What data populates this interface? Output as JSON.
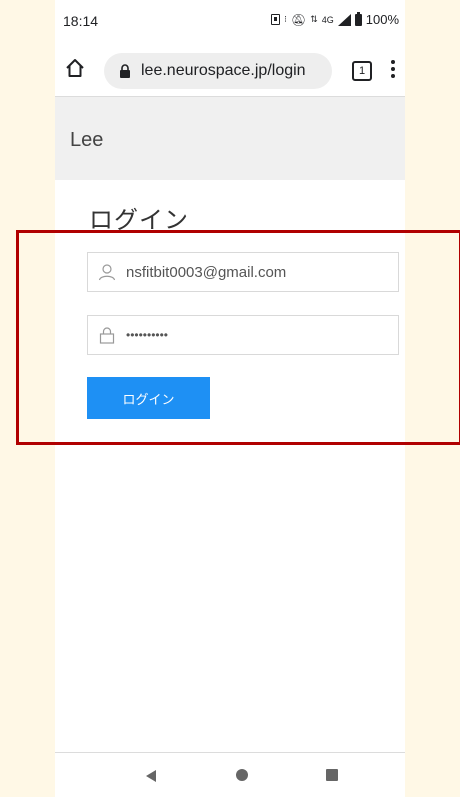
{
  "status_bar": {
    "time": "18:14",
    "network": "4G",
    "battery": "100%"
  },
  "browser": {
    "url": "lee.neurospace.jp/login",
    "tab_count": "1"
  },
  "app": {
    "brand": "Lee"
  },
  "login": {
    "heading": "ログイン",
    "email_value": "nsfitbit0003@gmail.com",
    "password_value": "••••••••••",
    "button_label": "ログイン"
  },
  "colors": {
    "accent": "#1e90f4",
    "highlight": "#b00000"
  }
}
